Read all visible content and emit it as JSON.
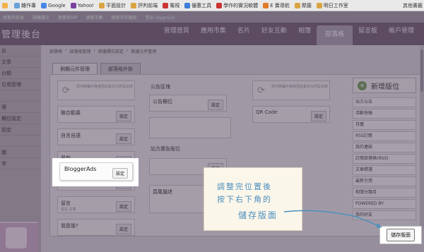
{
  "bookmarks": [
    {
      "label": "",
      "color": "#f2b24a"
    },
    {
      "label": "雜作專",
      "color": "#6aa0d8"
    },
    {
      "label": "Google",
      "color": "#4a86e8"
    },
    {
      "label": "Yahoo!",
      "color": "#7b3fa0"
    },
    {
      "label": "平面設計",
      "color": "#d9a441"
    },
    {
      "label": "評判前端",
      "color": "#d9a441"
    },
    {
      "label": "電視",
      "color": "#cc3333"
    },
    {
      "label": "優惠工具",
      "color": "#3b7dd8"
    },
    {
      "label": "學作的實況軟體",
      "color": "#cc3333"
    },
    {
      "label": "E 賣導航",
      "color": "#e07b2a"
    },
    {
      "label": "聚園",
      "color": "#d9a441"
    },
    {
      "label": "明日工作室",
      "color": "#d9a441"
    }
  ],
  "bookmarks_other": "其他書籤",
  "topnav": [
    "痞客邦首頁",
    "隨機選文",
    "痞客邦VIP",
    "網路市集",
    "痞客邦手機版",
    "登出 (AygnGe)"
  ],
  "site_title": "管理後台",
  "menu": [
    "管理首頁",
    "應用市集",
    "名片",
    "好友互動",
    "相簿",
    "部落格",
    "留言板",
    "帳戶管理"
  ],
  "menu_active": "部落格",
  "left_items": [
    "台",
    "文章",
    "分類",
    "引用管理",
    "",
    "理",
    "欄位設定",
    "設定",
    "",
    "圖",
    "字"
  ],
  "breadcrumb": [
    "部落格",
    "部落格管理",
    "側邊欄位設定",
    "側邊元件管理"
  ],
  "tabs": [
    "側欄元件管理",
    "部落格外掛"
  ],
  "upload_hint": "您可將圖片拖曳至此後在元件區出來",
  "set_label": "設定",
  "col1": [
    {
      "label": "聯合勸募",
      "sub": ""
    },
    {
      "label": "自言自語",
      "sub": ""
    },
    {
      "label": "最新",
      "sub": "發布 文章"
    },
    {
      "label": "",
      "sub": ""
    },
    {
      "label": "留言",
      "sub": "留言 文章"
    },
    {
      "label": "我是誰?",
      "sub": ""
    }
  ],
  "col2_title": "公告區塊",
  "col2_widget": "公告欄位",
  "col2_title2": "站方廣告版位",
  "col2_widget2": "頁尾描述",
  "col3_widget": "QR Code",
  "add_button": "新增版位",
  "right_list": [
    "站方公告",
    "活動快報",
    "月曆",
    "RSS訂閱",
    "我的連結",
    "訂閱部落格(RSS)",
    "文章精選",
    "最新引用",
    "相簿分類月",
    "POWERED BY",
    "我的好友"
  ],
  "blogger": {
    "label": "BloggerAds",
    "sub": "",
    "button": "設定"
  },
  "note": {
    "line1": "調整完位置後",
    "line2": "按下右下角的",
    "line3": "儲存版面"
  },
  "save_button": "儲存版面"
}
